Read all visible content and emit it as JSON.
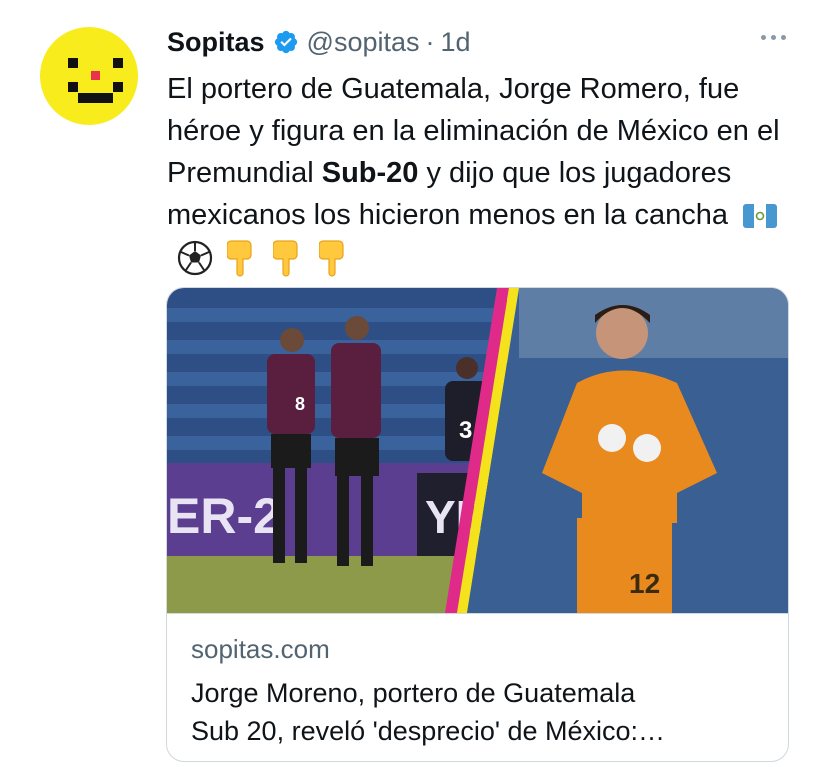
{
  "tweet": {
    "author_name": "Sopitas",
    "handle": "@sopitas",
    "separator": "·",
    "time": "1d",
    "text_part1": "El portero de Guatemala, Jorge Romero, fue héroe y figura en la eliminación de México en el Premundial ",
    "text_bold": "Sub-20",
    "text_part2": " y dijo que los jugadores mexicanos los hicieron menos en la cancha",
    "emojis": [
      "guatemala-flag-icon",
      "soccer-ball-icon",
      "point-down-icon",
      "point-down-icon",
      "point-down-icon"
    ]
  },
  "card": {
    "domain": "sopitas.com",
    "title_line1": "Jorge Moreno, portero de Guatemala",
    "title_line2": "Sub 20, reveló 'desprecio' de México:…",
    "image_texts": {
      "banner_left": "ER-2",
      "banner_right": "YES",
      "jersey_left": "8",
      "jersey_right": "3",
      "jersey_keeper": "12"
    }
  },
  "colors": {
    "verified_blue": "#1d9bf0",
    "avatar_yellow": "#f8ec1c",
    "muted": "#536471",
    "border": "#cfd9de"
  }
}
